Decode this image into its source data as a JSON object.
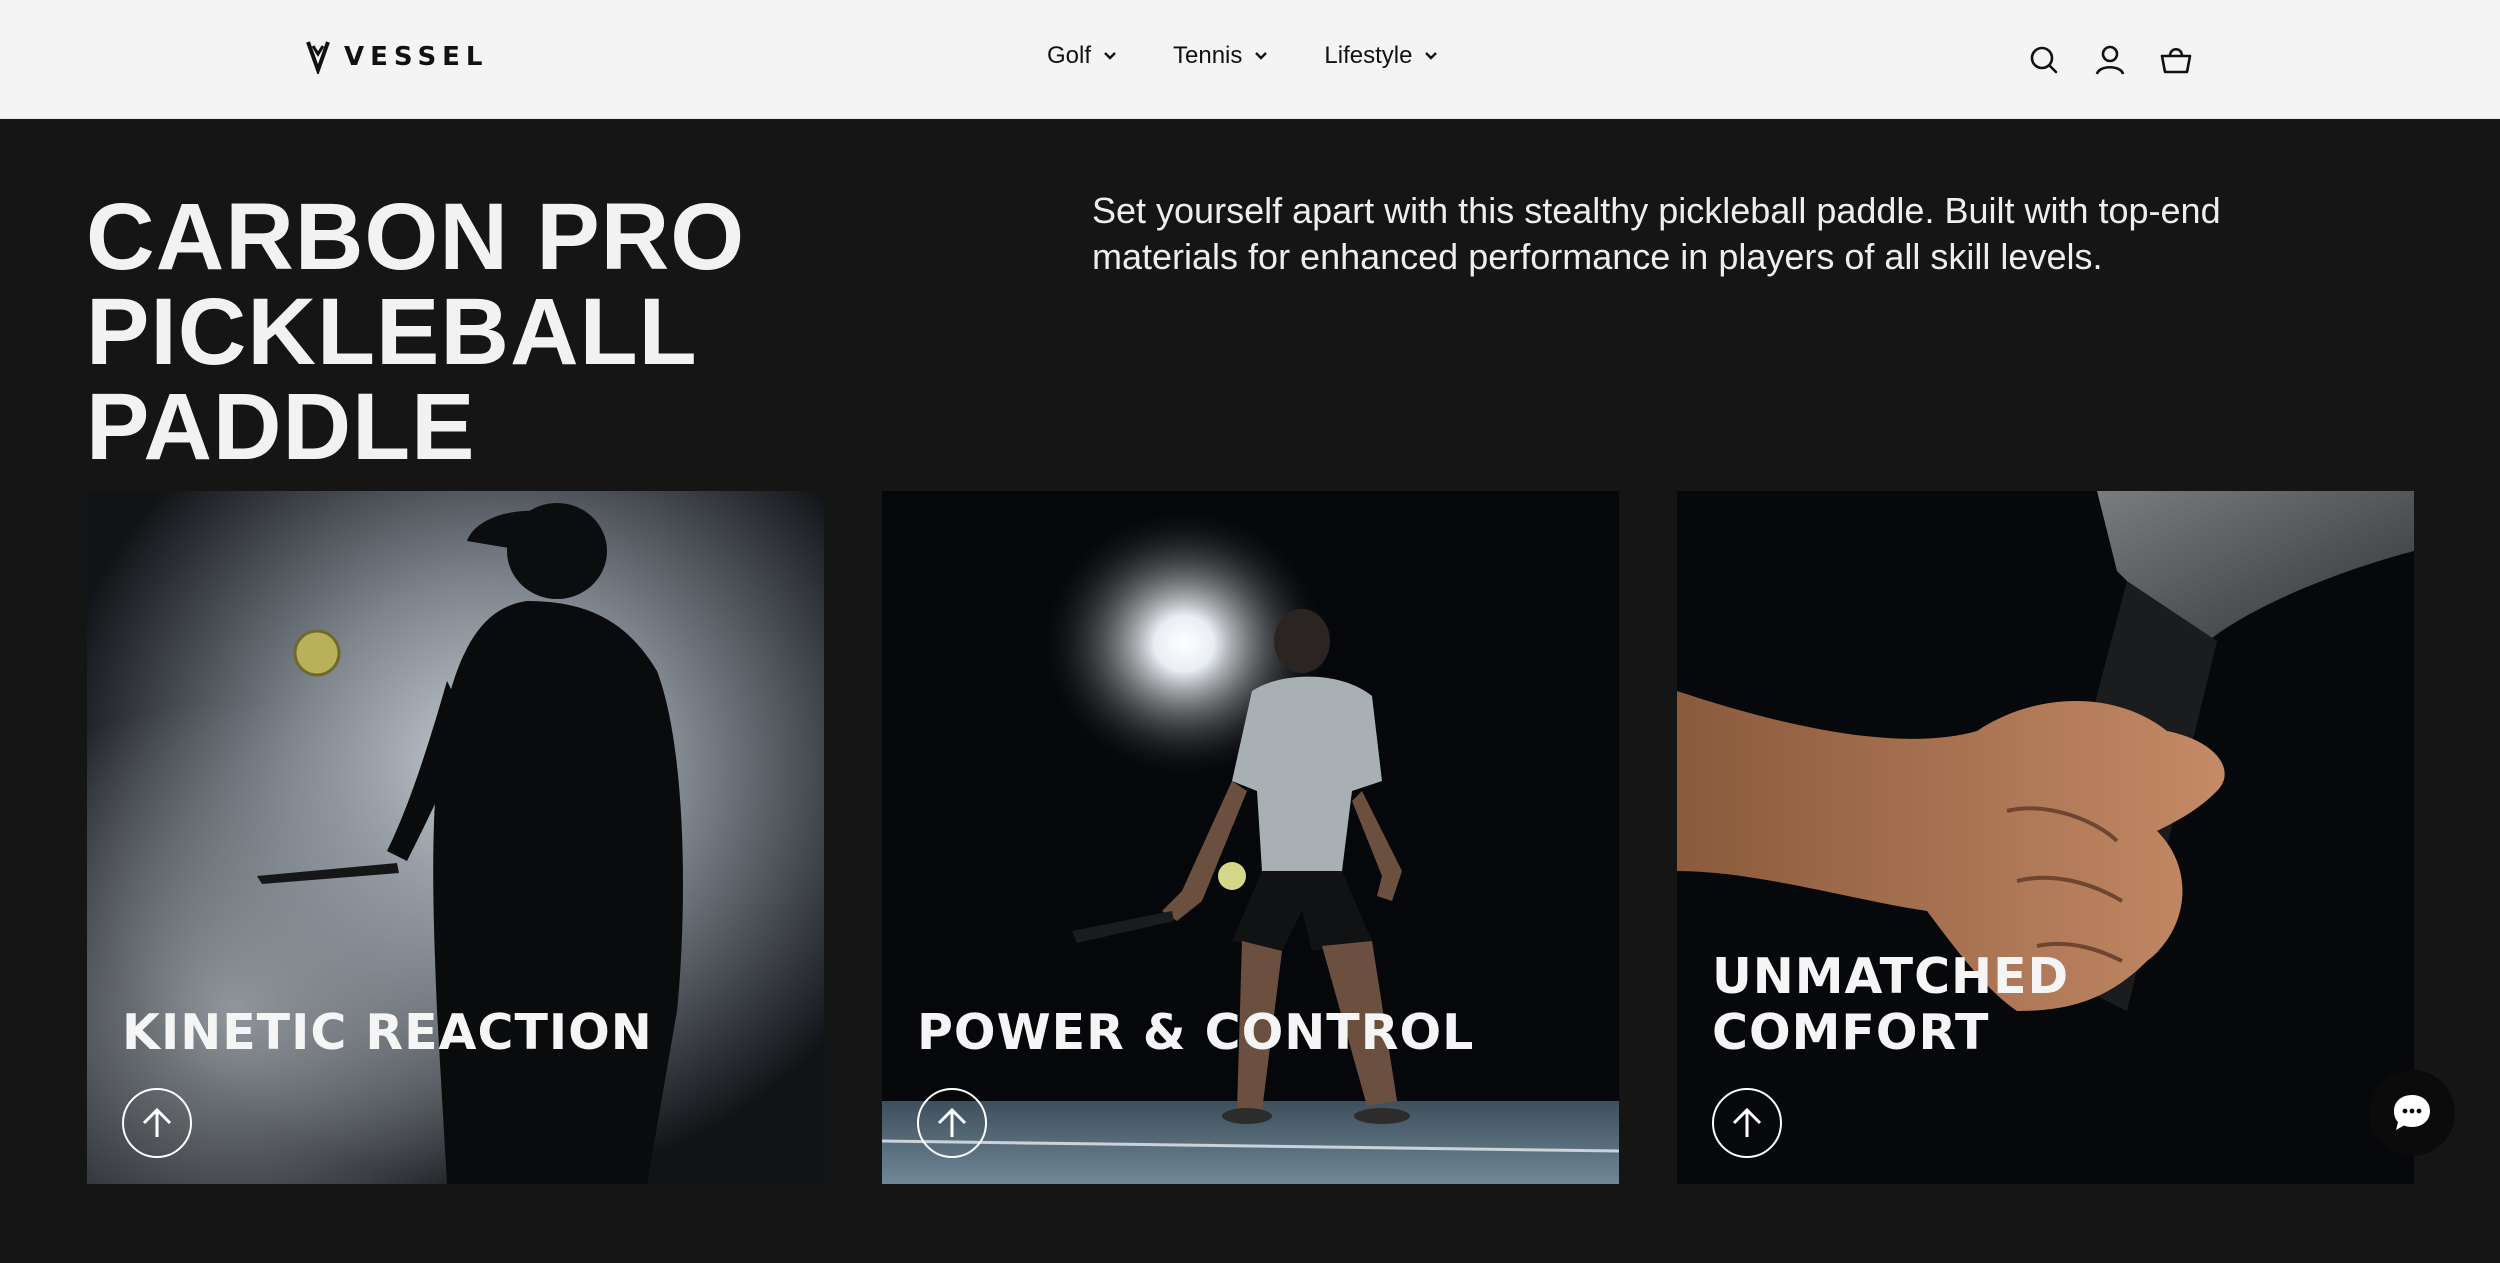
{
  "header": {
    "brand": "VESSEL",
    "nav": [
      {
        "label": "Golf"
      },
      {
        "label": "Tennis"
      },
      {
        "label": "Lifestyle"
      }
    ],
    "icons": [
      "search-icon",
      "account-icon",
      "cart-icon"
    ]
  },
  "hero": {
    "title_line1": "CARBON PRO",
    "title_line2": "PICKLEBALL PADDLE",
    "description": "Set yourself apart with this stealthy pickleball paddle. Built with top-end materials for enhanced performance in players of all skill levels."
  },
  "cards": [
    {
      "title": "KINETIC REACTION",
      "icon": "arrow-up-icon"
    },
    {
      "title": "POWER & CONTROL",
      "icon": "arrow-up-icon"
    },
    {
      "title_line1": "UNMATCHED",
      "title_line2": "COMFORT",
      "icon": "arrow-up-icon"
    }
  ],
  "chat": {
    "icon": "chat-icon"
  },
  "colors": {
    "header_bg": "#f4f4f4",
    "page_bg": "#151515",
    "text": "#ffffff"
  }
}
